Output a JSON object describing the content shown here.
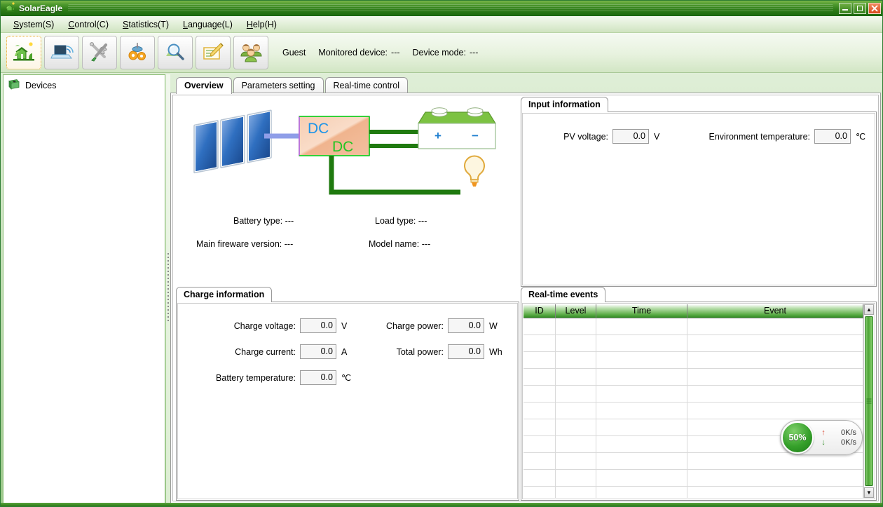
{
  "window": {
    "title": "SolarEagle",
    "app_icon": "solar-house-icon",
    "minimize_label": "Minimize",
    "maximize_label": "Maximize",
    "close_label": "Close"
  },
  "menubar": [
    {
      "name": "system",
      "pre": "S",
      "text": "ystem(S)"
    },
    {
      "name": "control",
      "pre": "C",
      "text": "ontrol(C)"
    },
    {
      "name": "statistics",
      "pre": "S",
      "text": "tatistics(T)"
    },
    {
      "name": "language",
      "pre": "L",
      "text": "anguage(L)"
    },
    {
      "name": "help",
      "pre": "H",
      "text": "elp(H)"
    }
  ],
  "toolbar": {
    "buttons": [
      {
        "name": "overview-button",
        "icon": "solar-house-icon",
        "active": true
      },
      {
        "name": "device-connect-button",
        "icon": "laptop-wifi-icon",
        "active": false
      },
      {
        "name": "tools-button",
        "icon": "tools-icon",
        "active": false
      },
      {
        "name": "settings-button",
        "icon": "gears-icon",
        "active": false
      },
      {
        "name": "search-button",
        "icon": "magnifier-icon",
        "active": false
      },
      {
        "name": "log-button",
        "icon": "notepad-pencil-icon",
        "active": false
      },
      {
        "name": "users-button",
        "icon": "users-group-icon",
        "active": false
      }
    ],
    "user": "Guest",
    "monitored_device_label": "Monitored device:",
    "monitored_device_value": "---",
    "device_mode_label": "Device mode:",
    "device_mode_value": "---"
  },
  "sidebar": {
    "root": {
      "label": "Devices",
      "icon": "devices-book-icon"
    }
  },
  "tabs": [
    {
      "name": "tab-overview",
      "label": "Overview",
      "active": true
    },
    {
      "name": "tab-parameters-setting",
      "label": "Parameters setting",
      "active": false
    },
    {
      "name": "tab-realtime-control",
      "label": "Real-time control",
      "active": false
    }
  ],
  "overview": {
    "diagram": {
      "converter_top_label": "DC",
      "converter_bottom_label": "DC",
      "battery_plus": "+",
      "battery_minus": "−"
    },
    "info": {
      "battery_type_label": "Battery type:",
      "battery_type_value": "---",
      "load_type_label": "Load type:",
      "load_type_value": "---",
      "firmware_label": "Main fireware version:",
      "firmware_value": "---",
      "model_label": "Model name:",
      "model_value": "---"
    }
  },
  "input_information": {
    "title": "Input information",
    "pv_voltage_label": "PV voltage:",
    "pv_voltage_value": "0.0",
    "pv_voltage_unit": "V",
    "env_temp_label": "Environment temperature:",
    "env_temp_value": "0.0",
    "env_temp_unit": "℃"
  },
  "charge_information": {
    "title": "Charge information",
    "fields": [
      {
        "name": "charge-voltage",
        "label": "Charge voltage:",
        "value": "0.0",
        "unit": "V"
      },
      {
        "name": "charge-current",
        "label": "Charge current:",
        "value": "0.0",
        "unit": "A"
      },
      {
        "name": "battery-temperature",
        "label": "Battery temperature:",
        "value": "0.0",
        "unit": "℃"
      },
      {
        "name": "charge-power",
        "label": "Charge power:",
        "value": "0.0",
        "unit": "W"
      },
      {
        "name": "total-power",
        "label": "Total power:",
        "value": "0.0",
        "unit": "Wh"
      }
    ]
  },
  "realtime_events": {
    "title": "Real-time events",
    "columns": [
      "ID",
      "Level",
      "Time",
      "Event"
    ],
    "rows": []
  },
  "speed_widget": {
    "percent": "50%",
    "upload": "0K/s",
    "download": "0K/s",
    "up_arrow": "↑",
    "down_arrow": "↓"
  },
  "colors": {
    "brand_green": "#2e7d18",
    "accent_green": "#4ea536",
    "header_green": "#5fae4a",
    "close_red": "#d94a1e"
  }
}
